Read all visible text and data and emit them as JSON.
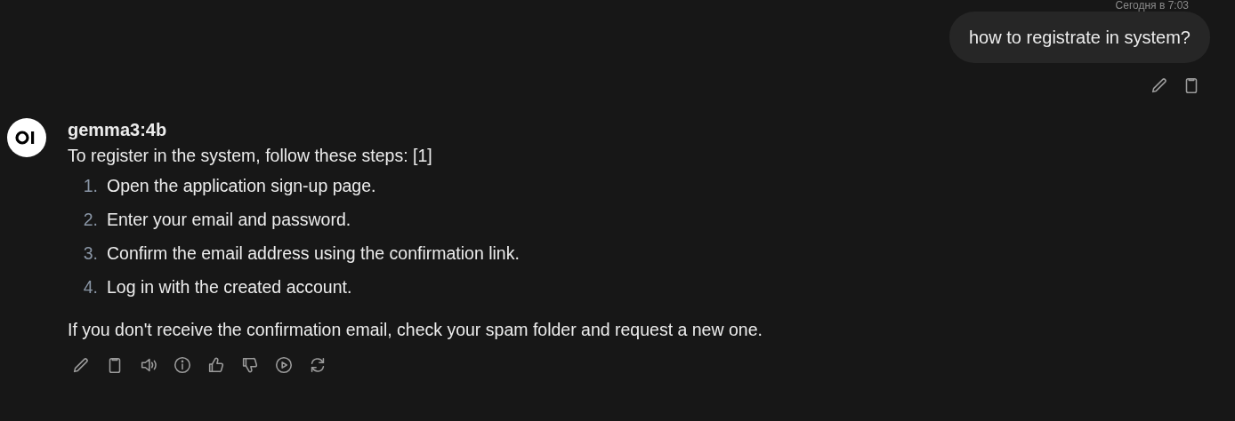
{
  "user_message": {
    "timestamp": "Сегодня в 7:03",
    "text": "how to registrate in system?"
  },
  "assistant_message": {
    "model": "gemma3:4b",
    "intro": "To register in the system, follow these steps: [1]",
    "steps": [
      {
        "number": "1.",
        "text": "Open the application sign-up page."
      },
      {
        "number": "2.",
        "text": "Enter your email and password."
      },
      {
        "number": "3.",
        "text": "Confirm the email address using the confirmation link."
      },
      {
        "number": "4.",
        "text": "Log in with the created account."
      }
    ],
    "outro": "If you don't receive the confirmation email, check your spam folder and request a new one."
  }
}
